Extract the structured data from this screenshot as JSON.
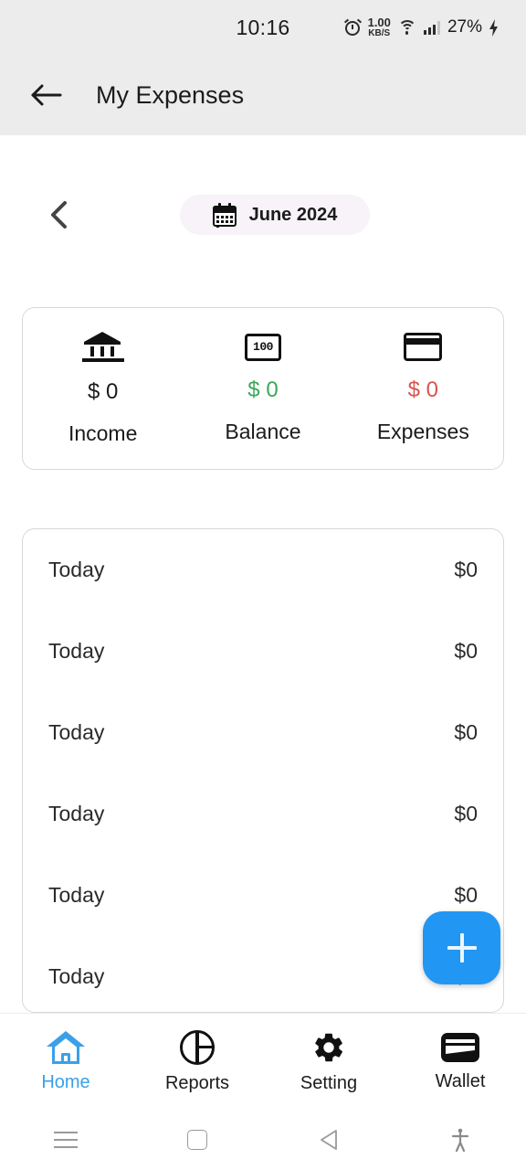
{
  "status_bar": {
    "time": "10:16",
    "alarm_icon": "alarm-icon",
    "network_speed_value": "1.00",
    "network_speed_unit": "KB/S",
    "wifi_icon": "wifi-icon",
    "signal_icon": "signal-bars-icon",
    "battery_percent": "27%",
    "charging_icon": "lightning-bolt-icon"
  },
  "app_bar": {
    "back_icon": "arrow-left-icon",
    "title": "My Expenses"
  },
  "month_selector": {
    "prev_icon": "chevron-left-icon",
    "calendar_icon": "calendar-icon",
    "label": "June 2024"
  },
  "summary": {
    "columns": [
      {
        "icon": "bank-icon",
        "amount": "$ 0",
        "label": "Income",
        "color": "#1b1b1b"
      },
      {
        "icon": "banknote-icon",
        "amount": "$ 0",
        "label": "Balance",
        "color": "#3aa758"
      },
      {
        "icon": "credit-card-icon",
        "amount": "$ 0",
        "label": "Expenses",
        "color": "#d9534f"
      }
    ],
    "banknote_text": "100"
  },
  "transactions": [
    {
      "date": "Today",
      "amount": "$0"
    },
    {
      "date": "Today",
      "amount": "$0"
    },
    {
      "date": "Today",
      "amount": "$0"
    },
    {
      "date": "Today",
      "amount": "$0"
    },
    {
      "date": "Today",
      "amount": "$0"
    },
    {
      "date": "Today",
      "amount": "$0"
    }
  ],
  "fab": {
    "icon": "plus-icon",
    "label": "+"
  },
  "bottom_nav": {
    "items": [
      {
        "icon": "home-icon",
        "label": "Home",
        "active": true
      },
      {
        "icon": "pie-chart-icon",
        "label": "Reports",
        "active": false
      },
      {
        "icon": "gear-icon",
        "label": "Setting",
        "active": false
      },
      {
        "icon": "wallet-icon",
        "label": "Wallet",
        "active": false
      }
    ],
    "active_color": "#3aa0e8"
  },
  "android_nav": {
    "recents_icon": "menu-icon",
    "home_icon": "square-icon",
    "back_icon": "triangle-back-icon",
    "accessibility_icon": "accessibility-person-icon"
  },
  "colors": {
    "header_bg": "#ececec",
    "chip_bg": "#f7f3f8",
    "fab_bg": "#2196f3",
    "accent": "#3aa0e8",
    "income": "#1b1b1b",
    "balance": "#3aa758",
    "expenses": "#d9534f"
  }
}
